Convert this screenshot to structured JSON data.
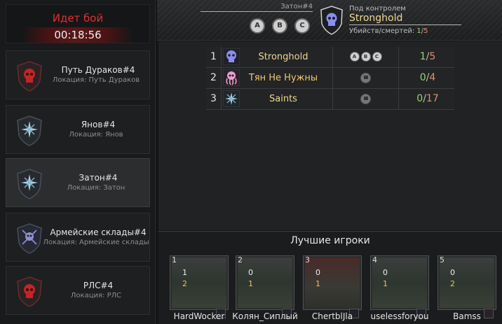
{
  "battle": {
    "title": "Идет бой",
    "timer": "00:18:56"
  },
  "locations": [
    {
      "name": "Путь Дураков#4",
      "sub": "Локация: Путь Дураков",
      "emblem": "red-skull-icon"
    },
    {
      "name": "Янов#4",
      "sub": "Локация: Янов",
      "emblem": "blue-star-icon"
    },
    {
      "name": "Затон#4",
      "sub": "Локация: Затон",
      "emblem": "blue-star-icon",
      "selected": true
    },
    {
      "name": "Армейские склады#4",
      "sub": "Локация: Армейские склады",
      "emblem": "crossed-skull-icon"
    },
    {
      "name": "РЛС#4",
      "sub": "Локация: РЛС",
      "emblem": "red-skull-icon"
    }
  ],
  "header": {
    "map_name": "Затон#4",
    "points": [
      "A",
      "B",
      "C"
    ],
    "under_control_label": "Под контролем",
    "controller": "Stronghold",
    "kd_label": "Убийств/смертей:",
    "kills": "1",
    "sep": "/",
    "deaths": "5"
  },
  "standings": [
    {
      "rank": "1",
      "name": "Stronghold",
      "name_color": "#f0d890",
      "icon": "purple-skull-icon",
      "cells": [
        "A",
        "B",
        "C"
      ],
      "kills": "1",
      "deaths": "5"
    },
    {
      "rank": "2",
      "name": "Тян Не Нужны",
      "name_color": "#f0c870",
      "icon": "pink-octopus-icon",
      "cells": [
        "flag"
      ],
      "kills": "0",
      "deaths": "4"
    },
    {
      "rank": "3",
      "name": "Saints",
      "name_color": "#f0d890",
      "icon": "blue-star-icon",
      "cells": [
        "flag"
      ],
      "kills": "0",
      "deaths": "17"
    }
  ],
  "best_title": "Лучшие игроки",
  "players": [
    {
      "num": "1",
      "v1": "1",
      "v2": "2",
      "name": "HardWocker"
    },
    {
      "num": "2",
      "v1": "0",
      "v2": "1",
      "name": "Колян_Сиплый"
    },
    {
      "num": "3",
      "v1": "0",
      "v2": "1",
      "name": "ChertblJla"
    },
    {
      "num": "4",
      "v1": "0",
      "v2": "1",
      "name": "uselessforyou"
    },
    {
      "num": "5",
      "v1": "0",
      "v2": "2",
      "name": "Bamss"
    }
  ]
}
